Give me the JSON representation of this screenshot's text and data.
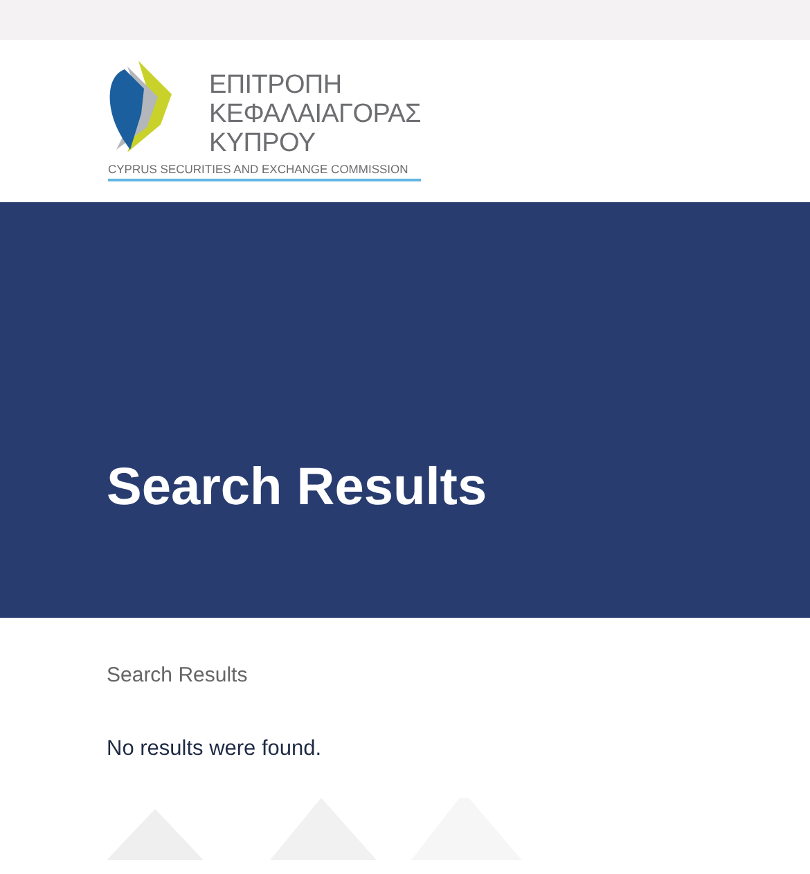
{
  "logo": {
    "lines": [
      "ΕΠΙΤΡΟΠΗ",
      "ΚΕΦΑΛΑΙΑΓΟΡΑΣ",
      "ΚΥΠΡΟΥ"
    ],
    "subtitle": "CYPRUS SECURITIES AND EXCHANGE COMMISSION"
  },
  "banner": {
    "title": "Search Results"
  },
  "breadcrumb": "Search Results",
  "message": "No results were found."
}
